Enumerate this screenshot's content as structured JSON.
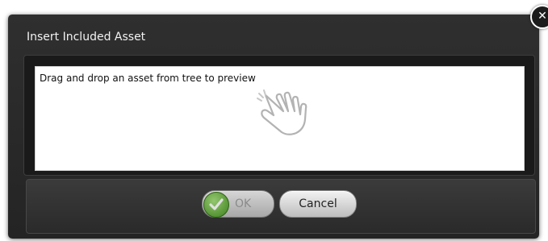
{
  "dialog": {
    "title": "Insert Included Asset",
    "preview_text": "Drag and drop an asset from tree to preview",
    "preview_icon": "drag-hand-icon",
    "ok_label": "OK",
    "cancel_label": "Cancel",
    "close_symbol": "✕",
    "ok_icon": "checkmark-icon"
  }
}
